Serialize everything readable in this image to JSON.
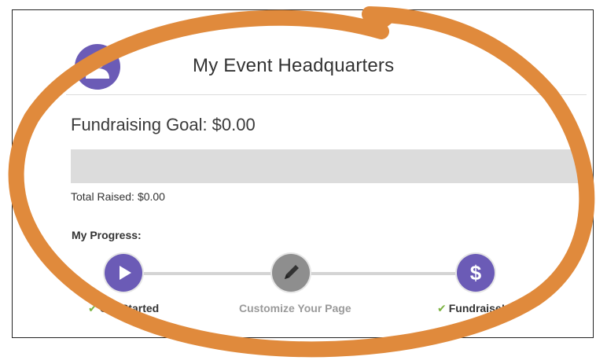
{
  "header": {
    "title": "My Event Headquarters",
    "avatar_icon": "user-avatar-icon"
  },
  "fundraising": {
    "goal_label": "Fundraising Goal:",
    "goal_amount": "$0.00",
    "progress_fraction": 0,
    "raised_label": "Total Raised:",
    "raised_amount": "$0.00"
  },
  "progress": {
    "label": "My Progress:",
    "steps": [
      {
        "label": "Get Started",
        "icon": "play-icon",
        "completed": true,
        "check_icon": "checkmark-icon"
      },
      {
        "label": "Customize Your Page",
        "icon": "pencil-icon",
        "completed": false
      },
      {
        "label": "Fundraise!",
        "icon": "dollar-icon",
        "completed": true,
        "check_icon": "checkmark-icon"
      }
    ]
  },
  "colors": {
    "accent_purple": "#6b5bb6",
    "inactive_gray": "#8e8e8e",
    "check_green": "#7cb342",
    "annotation_orange": "#e08a3c"
  }
}
